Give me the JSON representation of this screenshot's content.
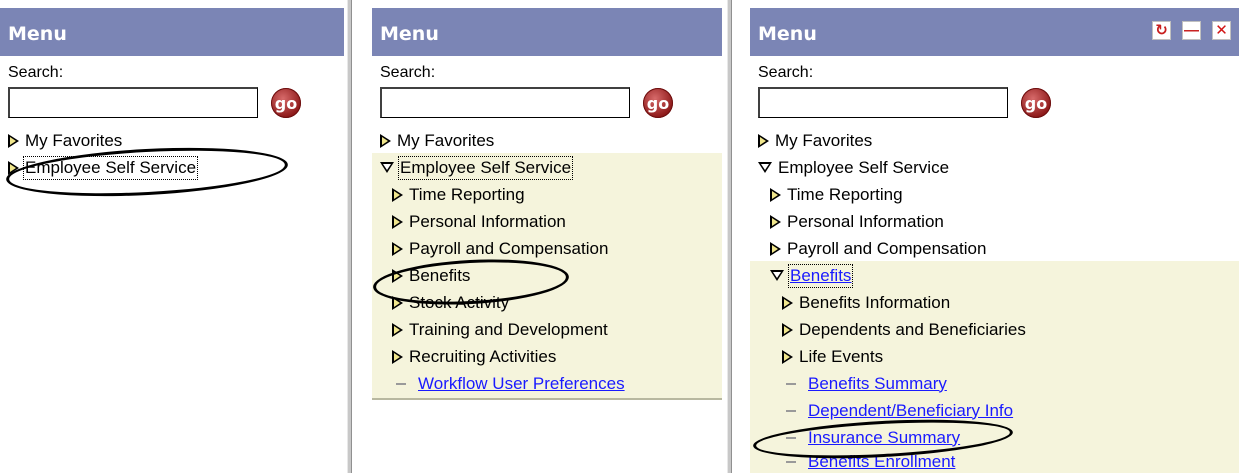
{
  "menu_title": "Menu",
  "search_label": "Search:",
  "search_value": "",
  "go_label": "go",
  "header_icons": [
    "refresh-icon",
    "minimize-icon",
    "close-icon"
  ],
  "panel1": {
    "items": [
      "My Favorites",
      "Employee Self Service"
    ]
  },
  "panel2": {
    "items": [
      "My Favorites",
      "Employee Self Service",
      "Time Reporting",
      "Personal Information",
      "Payroll and Compensation",
      "Benefits",
      "Stock Activity",
      "Training and Development",
      "Recruiting Activities",
      "Workflow User Preferences"
    ]
  },
  "panel3": {
    "items": [
      "My Favorites",
      "Employee Self Service",
      "Time Reporting",
      "Personal Information",
      "Payroll and Compensation",
      "Benefits",
      "Benefits Information",
      "Dependents and Beneficiaries",
      "Life Events",
      "Benefits Summary",
      "Dependent/Beneficiary Info",
      "Insurance Summary",
      "Benefits Enrollment"
    ]
  },
  "colors": {
    "header_bg": "#7b85b5",
    "tree_highlight_bg": "#f5f4dc",
    "link": "#1a1aff",
    "go_button": "#8e1a1a"
  }
}
